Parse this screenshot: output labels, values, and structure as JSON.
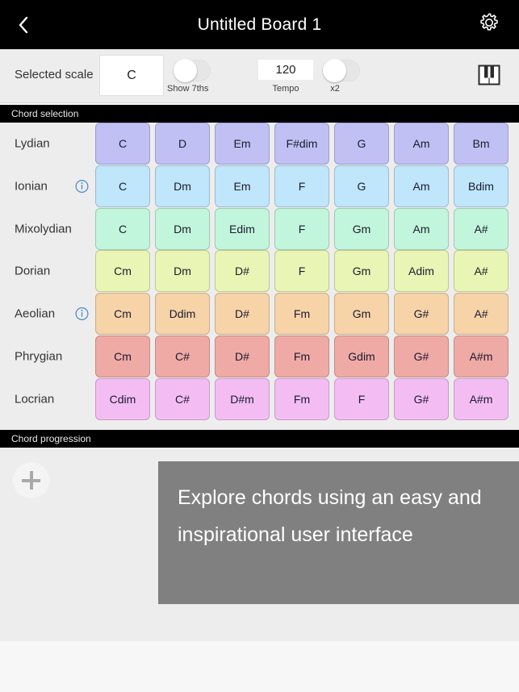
{
  "titlebar": {
    "back_icon": "chevron-left-icon",
    "title": "Untitled Board 1",
    "settings_icon": "gear-icon"
  },
  "toolbar": {
    "scale_label": "Selected scale",
    "scale_value": "C",
    "show_sevenths": {
      "caption": "Show 7ths",
      "state": "off"
    },
    "tempo": {
      "value": "120",
      "caption": "Tempo"
    },
    "double_time": {
      "caption": "x2",
      "state": "off"
    },
    "piano_icon": "piano-keyboard-icon"
  },
  "sections": {
    "chord_selection": "Chord selection",
    "chord_progression": "Chord progression"
  },
  "colors": {
    "lydian": "#c0c0f4",
    "ionian": "#bfe6fb",
    "mixolydian": "#c2f6dc",
    "dorian": "#e9f5b4",
    "aeolian": "#f7d3a8",
    "phrygian": "#efaaa5",
    "locrian": "#f3bdf3",
    "accent_info": "#4a86c8",
    "tooltip_bg": "#808080",
    "panel_bg": "#ededed",
    "titlebar_bg": "#000000"
  },
  "chord_grid": {
    "rows": [
      {
        "mode": "Lydian",
        "info": false,
        "color": "#c0c0f4",
        "chords": [
          "C",
          "D",
          "Em",
          "F#dim",
          "G",
          "Am",
          "Bm"
        ]
      },
      {
        "mode": "Ionian",
        "info": true,
        "color": "#bfe6fb",
        "chords": [
          "C",
          "Dm",
          "Em",
          "F",
          "G",
          "Am",
          "Bdim"
        ]
      },
      {
        "mode": "Mixolydian",
        "info": false,
        "color": "#c2f6dc",
        "chords": [
          "C",
          "Dm",
          "Edim",
          "F",
          "Gm",
          "Am",
          "A#"
        ]
      },
      {
        "mode": "Dorian",
        "info": false,
        "color": "#e9f5b4",
        "chords": [
          "Cm",
          "Dm",
          "D#",
          "F",
          "Gm",
          "Adim",
          "A#"
        ]
      },
      {
        "mode": "Aeolian",
        "info": true,
        "color": "#f7d3a8",
        "chords": [
          "Cm",
          "Ddim",
          "D#",
          "Fm",
          "Gm",
          "G#",
          "A#"
        ]
      },
      {
        "mode": "Phrygian",
        "info": false,
        "color": "#efaaa5",
        "chords": [
          "Cm",
          "C#",
          "D#",
          "Fm",
          "Gdim",
          "G#",
          "A#m"
        ]
      },
      {
        "mode": "Locrian",
        "info": false,
        "color": "#f3bdf3",
        "chords": [
          "Cdim",
          "C#",
          "D#m",
          "Fm",
          "F",
          "G#",
          "A#m"
        ]
      }
    ]
  },
  "progression": {
    "add_icon": "plus-icon",
    "tooltip_text": "Explore chords using an easy and inspirational user interface"
  }
}
